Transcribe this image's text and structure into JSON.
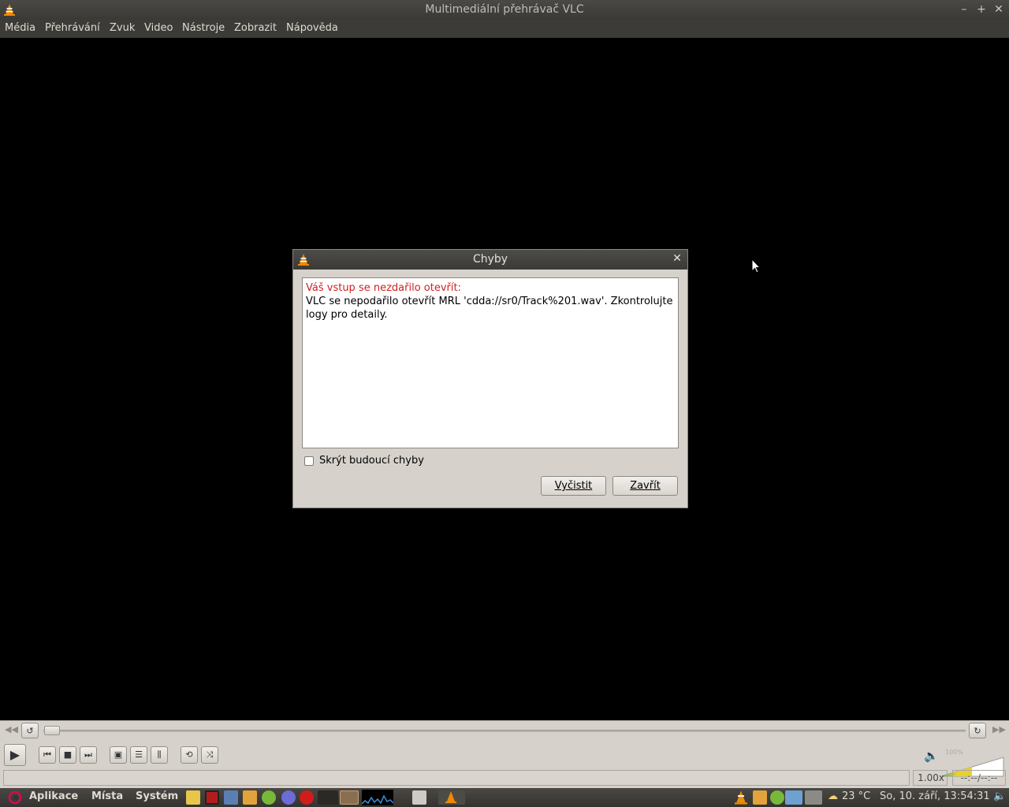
{
  "window": {
    "title": "Multimediální přehrávač VLC",
    "controls": [
      "–",
      "+",
      "✕"
    ]
  },
  "menu": [
    {
      "label": "Média"
    },
    {
      "label": "Přehrávání"
    },
    {
      "label": "Zvuk"
    },
    {
      "label": "Video"
    },
    {
      "label": "Nástroje"
    },
    {
      "label": "Zobrazit"
    },
    {
      "label": "Nápověda"
    }
  ],
  "dialog": {
    "title": "Chyby",
    "close": "✕",
    "error_heading": "Váš vstup se nezdařilo otevřít:",
    "error_body": "VLC se nepodařilo otevřít MRL 'cdda://sr0/Track%201.wav'. Zkontrolujte logy pro detaily.",
    "hide_future_label": "Skrýt budoucí chyby",
    "hide_future_checked": false,
    "clear_button": "Vyčistit",
    "close_button": "Zavřít"
  },
  "controls": {
    "speed": "1.00x",
    "time": "--:--/--:--",
    "volume_percent": "100%",
    "seek_position": 0
  },
  "taskbar": {
    "applications": "Aplikace",
    "places": "Místa",
    "system": "Systém",
    "temperature": "23 °C",
    "clock": "So, 10. září, 13:54:31"
  },
  "colors": {
    "error_text": "#d21f1f",
    "titlebar": "#3c3b37",
    "dialog_bg": "#d6d2cb",
    "vlc_orange": "#f08a00"
  }
}
